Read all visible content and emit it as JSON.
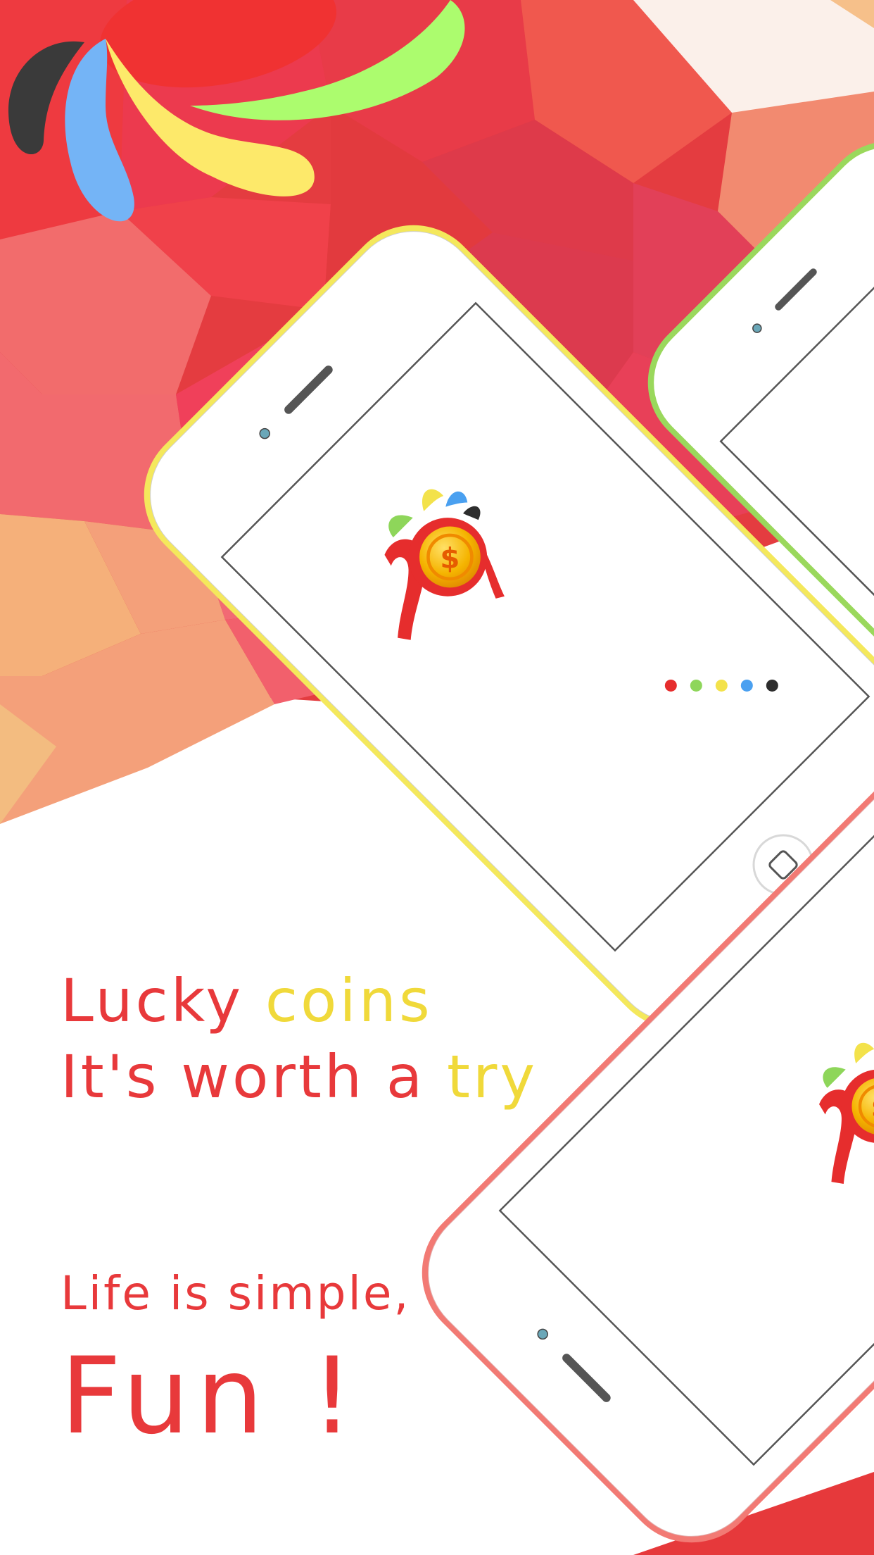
{
  "colors": {
    "brand_red": "#e8393b",
    "brand_yellow": "#f0d93a",
    "dot_colors": [
      "#e62d2d",
      "#8ed65a",
      "#f3e24b",
      "#4aa0f0",
      "#2d2d2d"
    ],
    "phone_frames": [
      "#f4e85c",
      "#9ad85c",
      "#f27a74"
    ]
  },
  "headline": {
    "line1_word1": "Lucky",
    "line1_word2": "coins",
    "line2_part1": "It's worth a",
    "line2_part2": "try"
  },
  "slogan": {
    "line1": "Life is simple,",
    "line2": "Fun !"
  },
  "phones": [
    {
      "frame": "yellow",
      "screen": "splash-logo-with-loading-dots"
    },
    {
      "frame": "green",
      "screen": "partially-visible"
    },
    {
      "frame": "red",
      "screen": "splash-logo"
    }
  ],
  "icons": [
    "splash-brush-strokes-logo",
    "coin-logo-icon",
    "dollar-coin-icon",
    "home-button-icon",
    "camera-icon",
    "speaker-icon",
    "loading-dots-icon"
  ]
}
